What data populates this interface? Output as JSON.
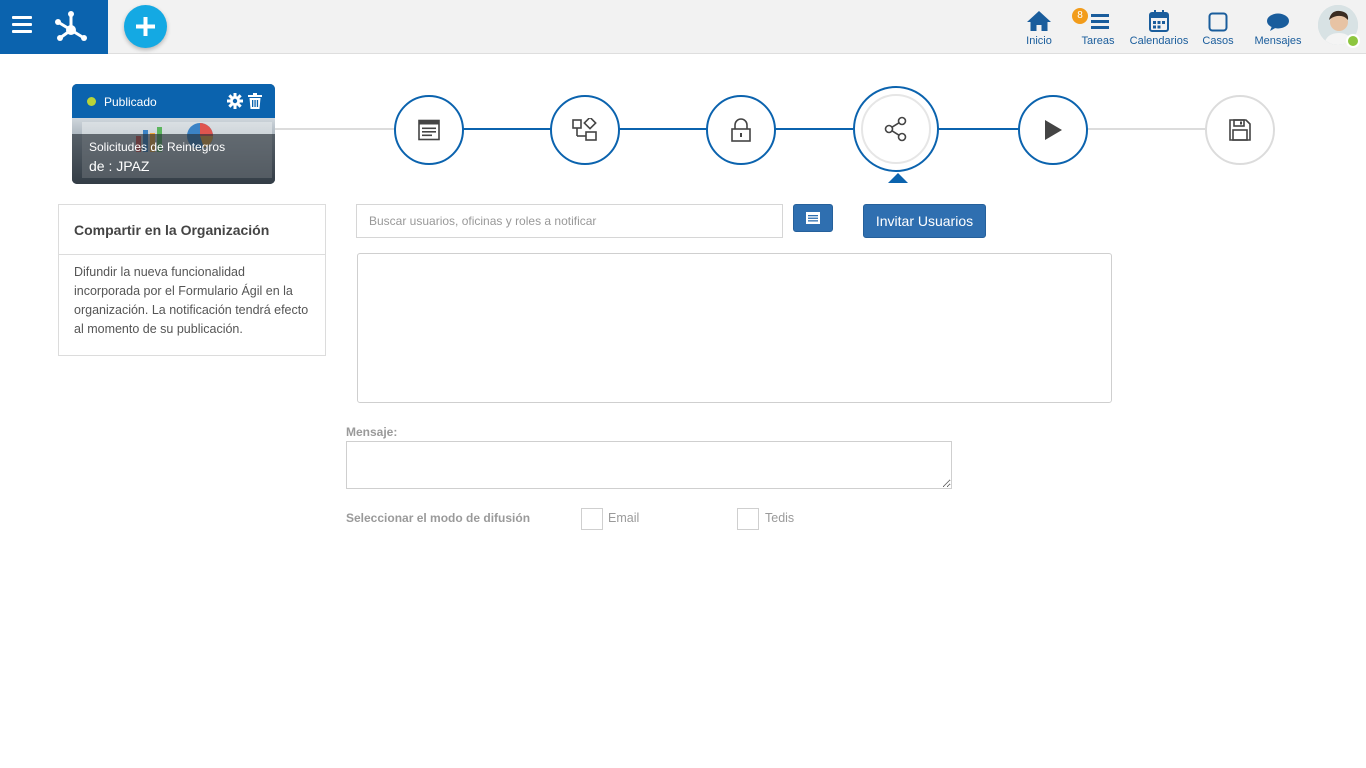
{
  "topbar": {
    "nav": [
      {
        "label": "Inicio",
        "icon": "home-icon"
      },
      {
        "label": "Tareas",
        "icon": "tasks-icon",
        "badge": "8"
      },
      {
        "label": "Calendarios",
        "icon": "calendar-icon"
      },
      {
        "label": "Casos",
        "icon": "cases-icon"
      },
      {
        "label": "Mensajes",
        "icon": "messages-icon"
      }
    ],
    "accent": "#0b63ae",
    "add_color": "#14a9e3"
  },
  "form_card": {
    "status": "Publicado",
    "title": "Solicitudes de Reintegros",
    "author": "de : JPAZ"
  },
  "steps": {
    "icons": [
      "form-icon",
      "flow-icon",
      "lock-icon",
      "share-icon",
      "play-icon",
      "save-icon"
    ],
    "active": "share-icon"
  },
  "info": {
    "title": "Compartir en la Organización",
    "description": "Difundir la nueva funcionalidad incorporada por el Formulario Ágil en la organización. La notificación tendrá efecto al momento de su publicación."
  },
  "share": {
    "search_placeholder": "Buscar usuarios, oficinas y roles a notificar",
    "invite_label": "Invitar Usuarios",
    "message_label": "Mensaje:",
    "mode_label": "Seleccionar el modo de difusión",
    "options": [
      "Email",
      "Tedis"
    ]
  }
}
